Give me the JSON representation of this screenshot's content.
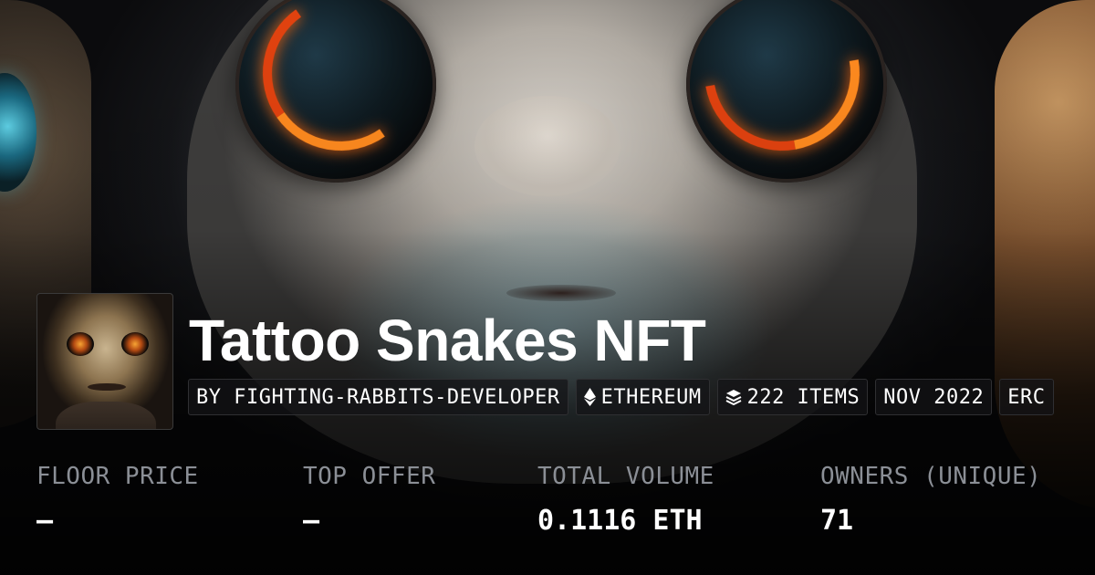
{
  "collection": {
    "name": "Tattoo Snakes NFT",
    "chips": {
      "creator": "BY FIGHTING-RABBITS-DEVELOPER",
      "chain": "ETHEREUM",
      "items": "222 ITEMS",
      "created": "NOV 2022",
      "standard": "ERC"
    }
  },
  "stats": {
    "floor_price": {
      "label": "FLOOR PRICE",
      "value": "–"
    },
    "top_offer": {
      "label": "TOP OFFER",
      "value": "–"
    },
    "total_volume": {
      "label": "TOTAL VOLUME",
      "value": "0.1116 ETH"
    },
    "owners": {
      "label": "OWNERS (UNIQUE)",
      "value": "71"
    }
  },
  "icons": {
    "chain": "ethereum-icon",
    "items": "layers-icon"
  }
}
